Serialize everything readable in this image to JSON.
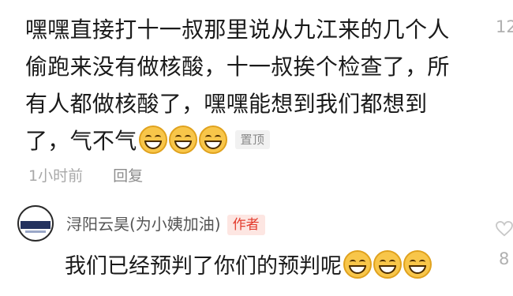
{
  "comment": {
    "text_lines": [
      "嘿嘿直接打十一叔那里说从九江来的几个人",
      "偷跑来没有做核酸，十一叔挨个检查了，所",
      "有人都做核酸了，嘿嘿能想到我们都想到",
      "了，气不气"
    ],
    "emoji_count": 3,
    "pin_label": "置顶",
    "time": "1小时前",
    "reply_label": "回复",
    "like_count": "12"
  },
  "reply": {
    "username": "浔阳云昊(为小姨加油)",
    "author_badge": "作者",
    "text": "我们已经预判了你们的预判呢",
    "emoji_count": 3,
    "like_count": "8"
  },
  "colors": {
    "author_badge_text": "#e33c2e",
    "author_badge_bg": "#fde6e2",
    "meta_gray": "#a8a8a8"
  },
  "icons": {
    "emoji": "grinning-face-icon",
    "like": "heart-icon"
  }
}
